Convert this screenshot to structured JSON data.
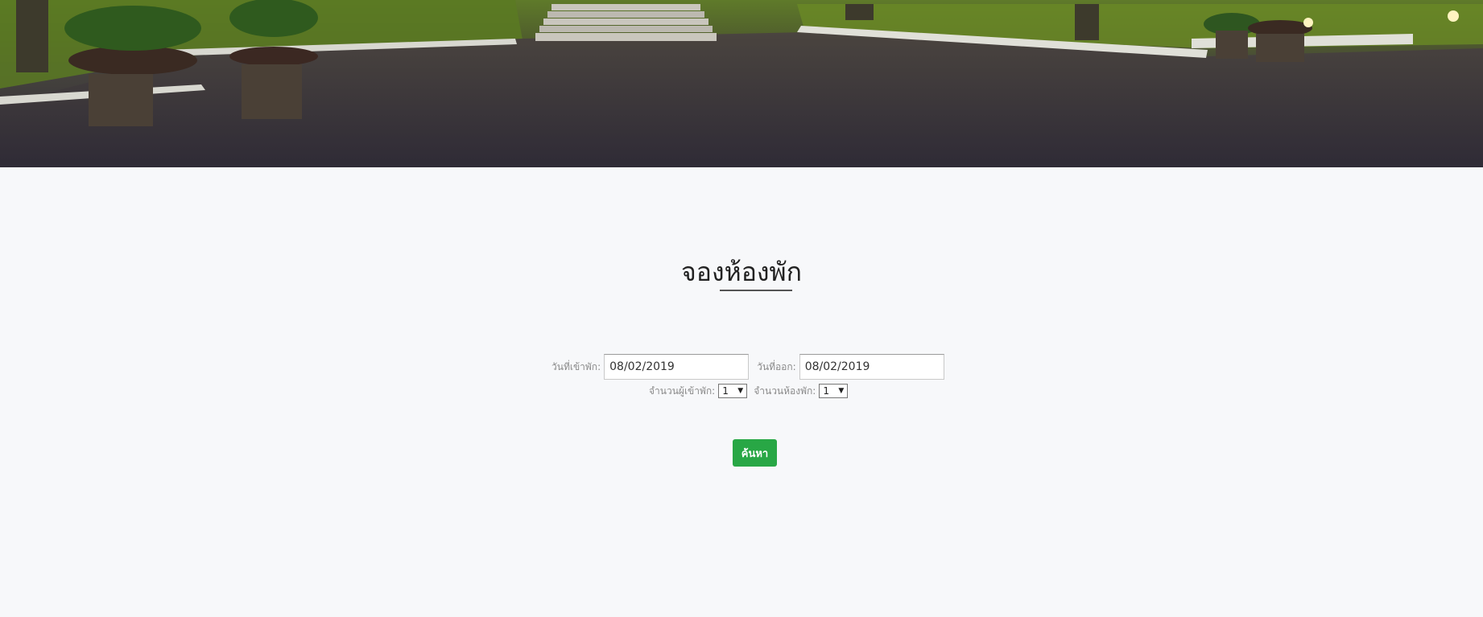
{
  "hero": {
    "image_description": "",
    "icon": "hero-image"
  },
  "booking": {
    "title": "จองห้องพัก",
    "checkin_label": "วันที่เข้าพัก:",
    "checkin_value": "08/02/2019",
    "checkout_label": "วันที่ออก:",
    "checkout_value": "08/02/2019",
    "guests_label": "จำนวนผู้เข้าพัก:",
    "guests_value": "1",
    "rooms_label": "จำนวนห้องพัก:",
    "rooms_value": "1",
    "search_label": "ค้นหา"
  },
  "colors": {
    "page_background": "#f7f8fa",
    "button_green": "#28a745",
    "title_text": "#222222",
    "label_text": "#8a8a8a"
  }
}
